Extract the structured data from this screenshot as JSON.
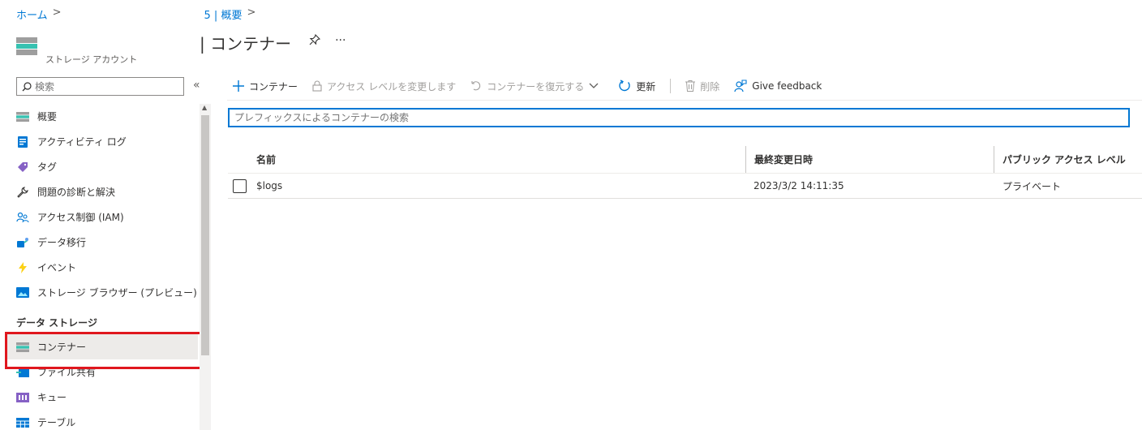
{
  "breadcrumb": {
    "home": "ホーム",
    "sep": ">",
    "parent": "5 | 概要"
  },
  "header": {
    "title": "| コンテナー",
    "subtitle": "ストレージ アカウント"
  },
  "sidebar": {
    "search_placeholder": "検索",
    "items": [
      {
        "label": "概要",
        "icon": "overview-icon"
      },
      {
        "label": "アクティビティ ログ",
        "icon": "activity-log-icon"
      },
      {
        "label": "タグ",
        "icon": "tag-icon"
      },
      {
        "label": "問題の診断と解決",
        "icon": "wrench-icon"
      },
      {
        "label": "アクセス制御 (IAM)",
        "icon": "people-icon"
      },
      {
        "label": "データ移行",
        "icon": "data-migration-icon"
      },
      {
        "label": "イベント",
        "icon": "lightning-icon"
      },
      {
        "label": "ストレージ ブラウザー (プレビュー)",
        "icon": "storage-browser-icon"
      }
    ],
    "section": "データ ストレージ",
    "storage_items": [
      {
        "label": "コンテナー",
        "icon": "container-icon",
        "active": true
      },
      {
        "label": "ファイル共有",
        "icon": "file-share-icon"
      },
      {
        "label": "キュー",
        "icon": "queue-icon"
      },
      {
        "label": "テーブル",
        "icon": "table-icon"
      }
    ]
  },
  "toolbar": {
    "add": "コンテナー",
    "access_level": "アクセス レベルを変更します",
    "restore": "コンテナーを復元する",
    "refresh": "更新",
    "delete": "削除",
    "feedback": "Give feedback"
  },
  "filter": {
    "placeholder": "プレフィックスによるコンテナーの検索"
  },
  "table": {
    "headers": [
      "名前",
      "最終変更日時",
      "パブリック アクセス レベル"
    ],
    "rows": [
      {
        "name": "$logs",
        "modified": "2023/3/2 14:11:35",
        "access": "プライベート"
      }
    ]
  },
  "colors": {
    "accent": "#0078d4",
    "highlight": "#e0171e"
  }
}
